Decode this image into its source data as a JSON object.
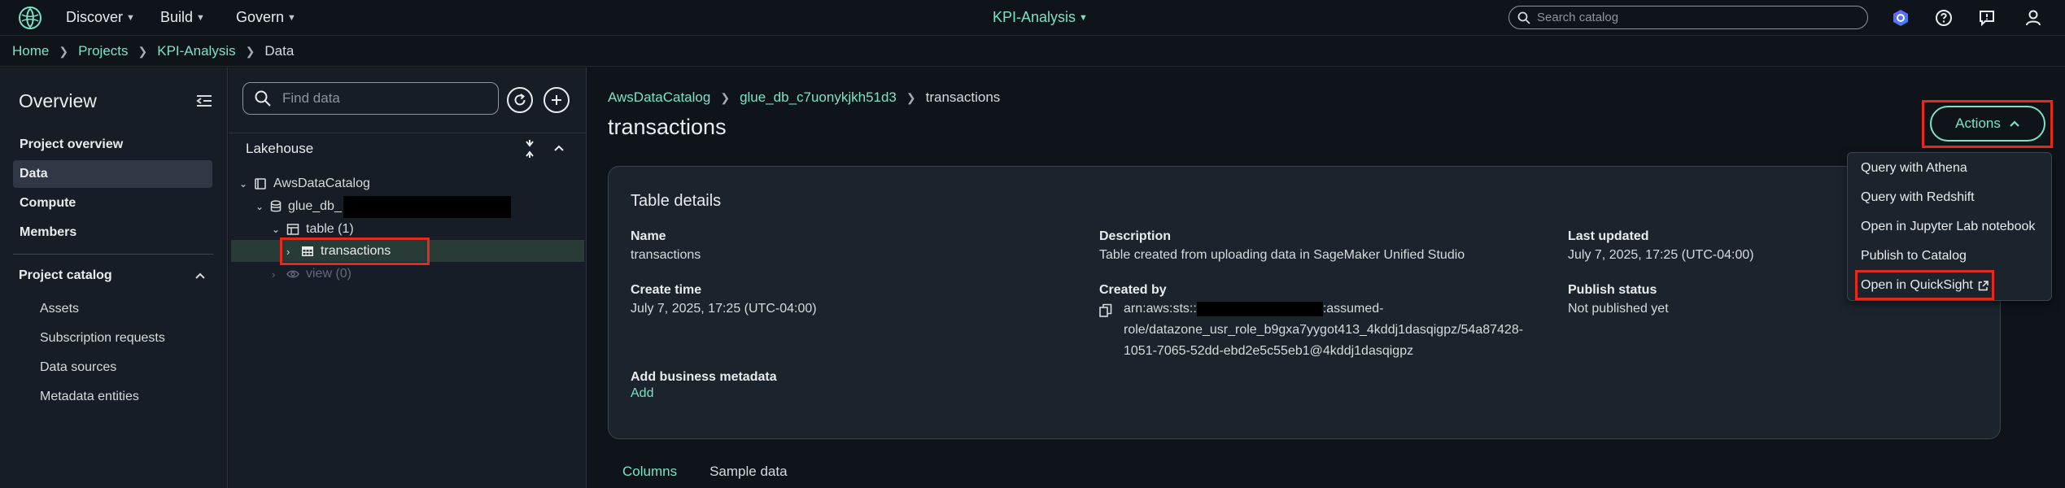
{
  "topnav": {
    "menus": [
      "Discover",
      "Build",
      "Govern"
    ],
    "project": "KPI-Analysis",
    "search_placeholder": "Search catalog"
  },
  "breadcrumb": {
    "items": [
      "Home",
      "Projects",
      "KPI-Analysis"
    ],
    "current": "Data"
  },
  "sidenav": {
    "title": "Overview",
    "items": [
      {
        "label": "Project overview"
      },
      {
        "label": "Data",
        "active": true
      },
      {
        "label": "Compute"
      },
      {
        "label": "Members"
      }
    ],
    "section": "Project catalog",
    "subitems": [
      "Assets",
      "Subscription requests",
      "Data sources",
      "Metadata entities"
    ]
  },
  "explorer": {
    "find_placeholder": "Find data",
    "section": "Lakehouse",
    "tree": {
      "catalog": "AwsDataCatalog",
      "database": "glue_db_",
      "table_group": "table (1)",
      "table": "transactions",
      "view_group": "view (0)"
    }
  },
  "main": {
    "crumb": [
      "AwsDataCatalog",
      "glue_db_c7uonykjkh51d3"
    ],
    "crumb_current": "transactions",
    "title": "transactions",
    "actions_label": "Actions",
    "card": {
      "title": "Table details",
      "name_label": "Name",
      "name_value": "transactions",
      "description_label": "Description",
      "description_value": "Table created from uploading data in SageMaker Unified Studio",
      "updated_label": "Last updated",
      "updated_value": "July 7, 2025, 17:25 (UTC-04:00)",
      "created_time_label": "Create time",
      "created_time_value": "July 7, 2025, 17:25 (UTC-04:00)",
      "created_by_label": "Created by",
      "created_by_prefix": "arn:aws:sts::",
      "created_by_line1_tail": ":assumed-",
      "created_by_line2": "role/datazone_usr_role_b9gxa7yygot413_4kddj1dasqigpz/54a87428-",
      "created_by_line3": "1051-7065-52dd-ebd2e5c55eb1@4kddj1dasqigpz",
      "publish_label": "Publish status",
      "publish_value": "Not published yet",
      "metadata_label": "Add business metadata",
      "add_label": "Add"
    },
    "tabs": [
      "Columns",
      "Sample data"
    ]
  },
  "actions_menu": {
    "items": [
      "Query with Athena",
      "Query with Redshift",
      "Open in Jupyter Lab notebook",
      "Publish to Catalog",
      "Open in QuickSight"
    ]
  },
  "colors": {
    "accent": "#7de2c5",
    "highlight": "#e52a1b",
    "background": "#0f141a",
    "panel": "#161d26"
  }
}
